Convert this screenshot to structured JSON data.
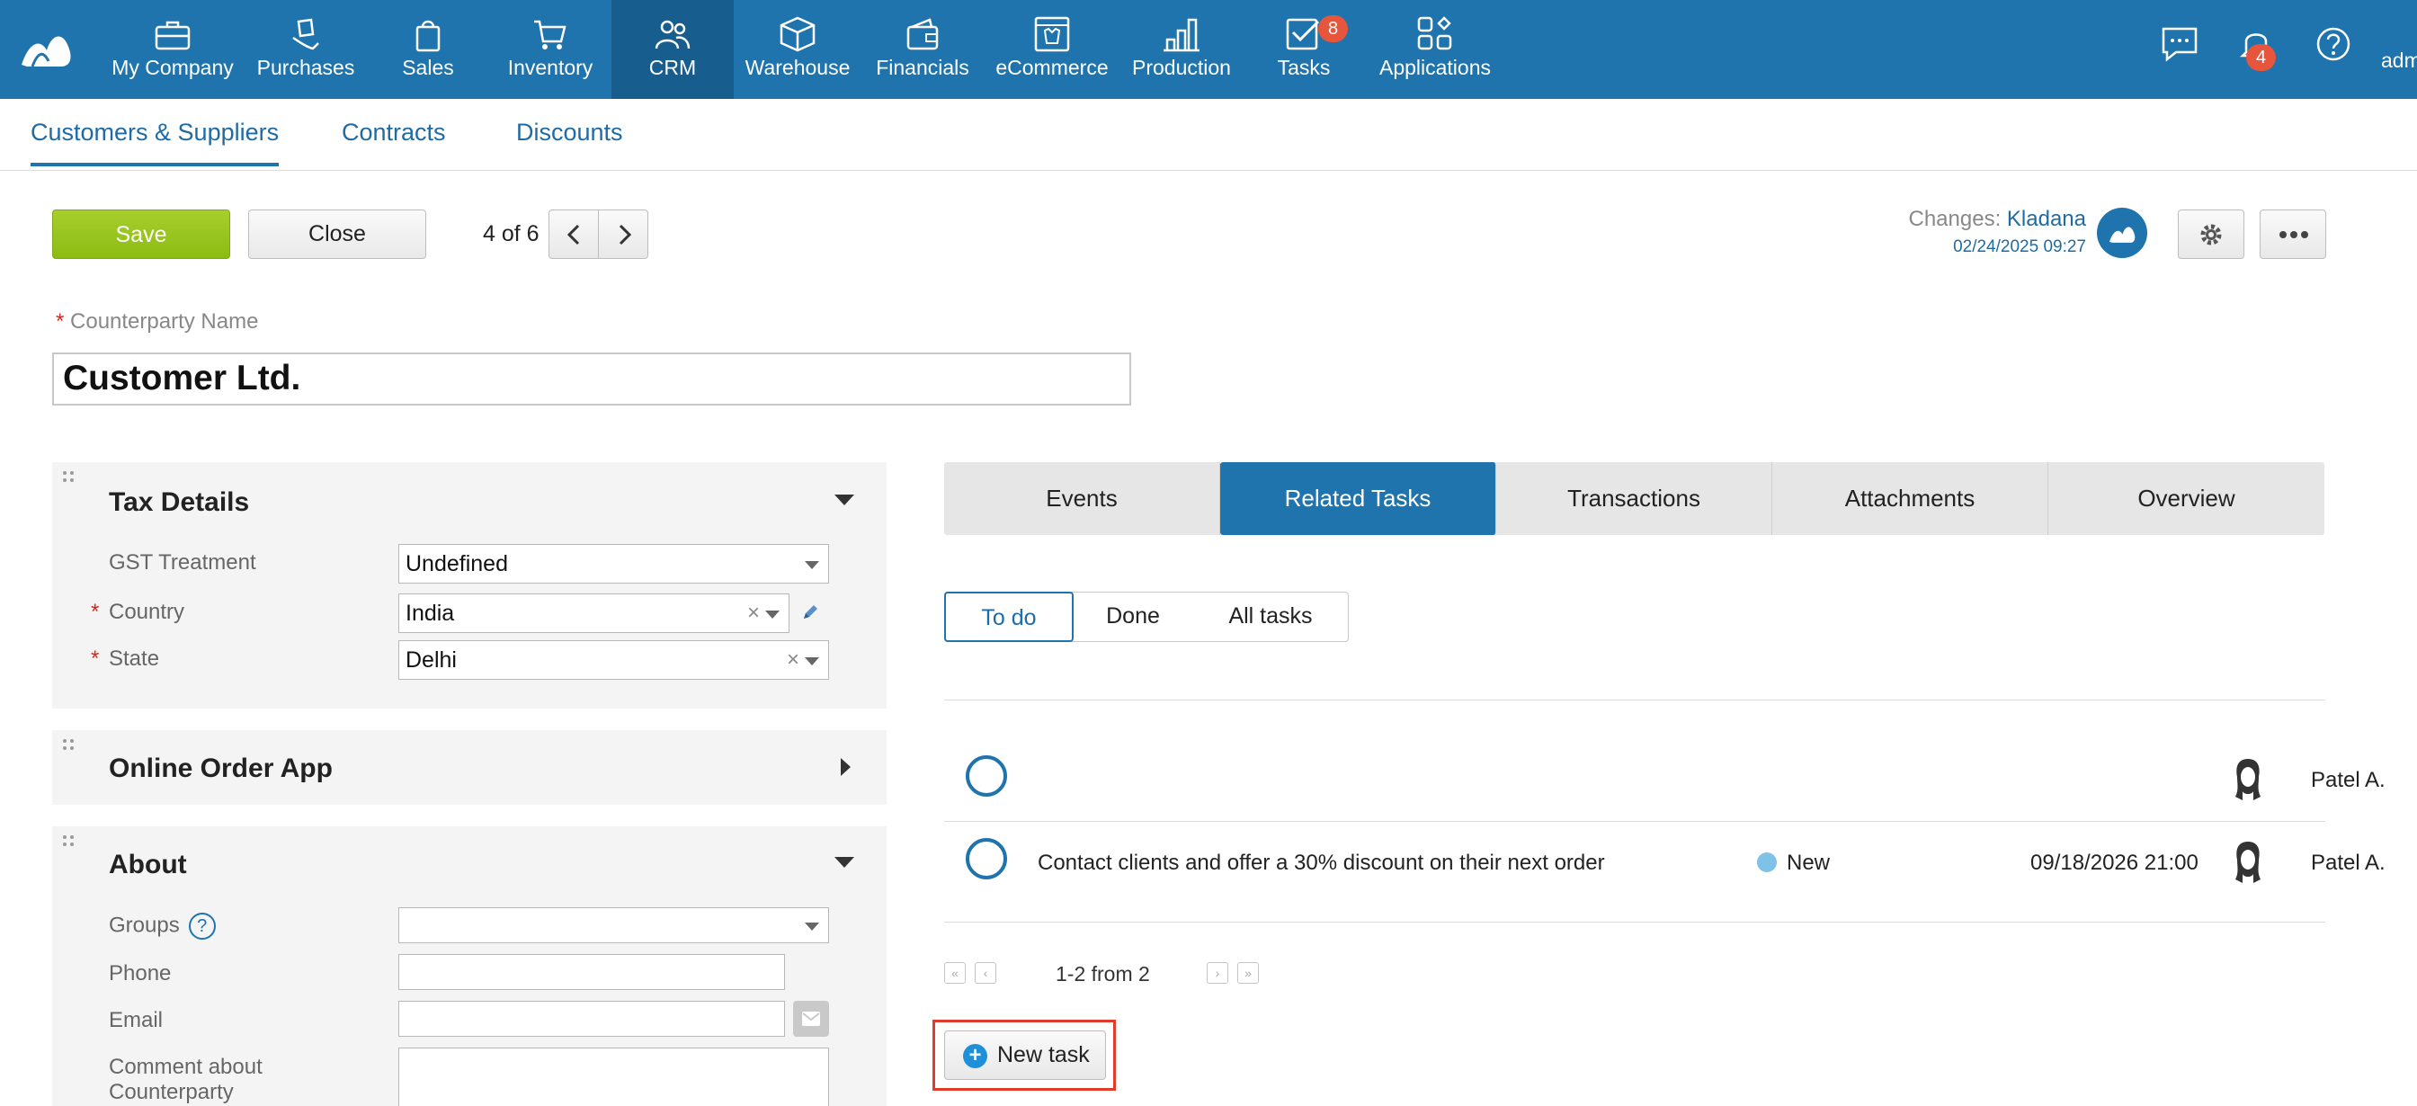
{
  "nav": {
    "items": [
      {
        "label": "My Company",
        "icon": "briefcase-icon"
      },
      {
        "label": "Purchases",
        "icon": "hand-bag-icon"
      },
      {
        "label": "Sales",
        "icon": "shopping-bag-icon"
      },
      {
        "label": "Inventory",
        "icon": "cart-icon"
      },
      {
        "label": "CRM",
        "icon": "people-icon"
      },
      {
        "label": "Warehouse",
        "icon": "box-icon"
      },
      {
        "label": "Financials",
        "icon": "wallet-icon"
      },
      {
        "label": "eCommerce",
        "icon": "storefront-icon"
      },
      {
        "label": "Production",
        "icon": "factory-icon"
      },
      {
        "label": "Tasks",
        "icon": "checkbox-icon"
      },
      {
        "label": "Applications",
        "icon": "grid-icon"
      }
    ],
    "active": "CRM",
    "tasks_badge": "8",
    "notifications_badge": "4",
    "user_label": "adm"
  },
  "subnav": {
    "tabs": [
      "Customers & Suppliers",
      "Contracts",
      "Discounts"
    ],
    "active": "Customers & Suppliers"
  },
  "toolbar": {
    "save_label": "Save",
    "close_label": "Close",
    "record_counter": "4 of 6",
    "changes_prefix": "Changes:",
    "changes_by": "Kladana",
    "changes_date": "02/24/2025 09:27"
  },
  "counterparty": {
    "name_label": "Counterparty Name",
    "name_value": "Customer Ltd."
  },
  "tax_details": {
    "title": "Tax Details",
    "gst_label": "GST Treatment",
    "gst_value": "Undefined",
    "country_label": "Country",
    "country_value": "India",
    "state_label": "State",
    "state_value": "Delhi"
  },
  "online_order": {
    "title": "Online Order App"
  },
  "about": {
    "title": "About",
    "groups_label": "Groups",
    "help_symbol": "?",
    "phone_label": "Phone",
    "email_label": "Email",
    "comment_label_line1": "Comment about",
    "comment_label_line2": "Counterparty"
  },
  "right_tabs": {
    "tabs": [
      "Events",
      "Related Tasks",
      "Transactions",
      "Attachments",
      "Overview"
    ],
    "active": "Related Tasks"
  },
  "task_filter": {
    "options": [
      "To do",
      "Done",
      "All tasks"
    ],
    "active": "To do"
  },
  "tasks": [
    {
      "text": "",
      "status": "",
      "due": "",
      "assignee": "Patel A."
    },
    {
      "text": "Contact clients and offer a 30% discount on their next order",
      "status": "New",
      "due": "09/18/2026 21:00",
      "assignee": "Patel A."
    }
  ],
  "pagination": {
    "summary": "1-2 from 2"
  },
  "new_task_label": "New task",
  "colors": {
    "brand": "#1f74ad",
    "save": "#96c41e",
    "badge": "#e8553d",
    "status_new": "#7ec2e8",
    "highlight": "#e03c2b"
  }
}
